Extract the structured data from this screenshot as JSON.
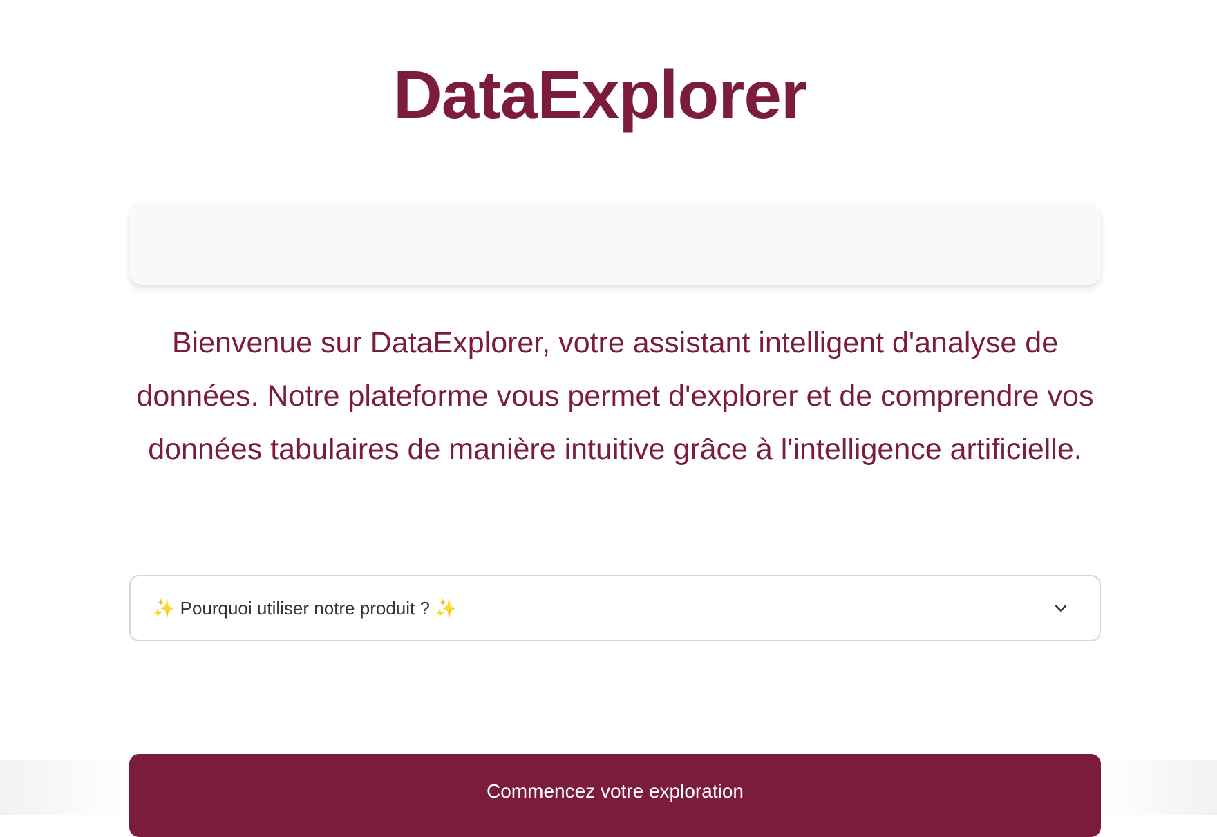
{
  "app": {
    "title": "DataExplorer"
  },
  "intro": {
    "text": "Bienvenue sur DataExplorer, votre assistant intelligent d'analyse de données. Notre plateforme vous permet d'explorer et de comprendre vos données tabulaires de manière intuitive grâce à l'intelligence artificielle."
  },
  "expander": {
    "label": "✨ Pourquoi utiliser notre produit ? ✨",
    "icon": "chevron-down-icon",
    "expanded": false
  },
  "cta": {
    "label": "Commencez votre exploration"
  },
  "colors": {
    "brand": "#7b1c3e",
    "banner_bg": "#f8f9fa",
    "text_dark": "#31333f",
    "border": "#d6d6d9"
  }
}
